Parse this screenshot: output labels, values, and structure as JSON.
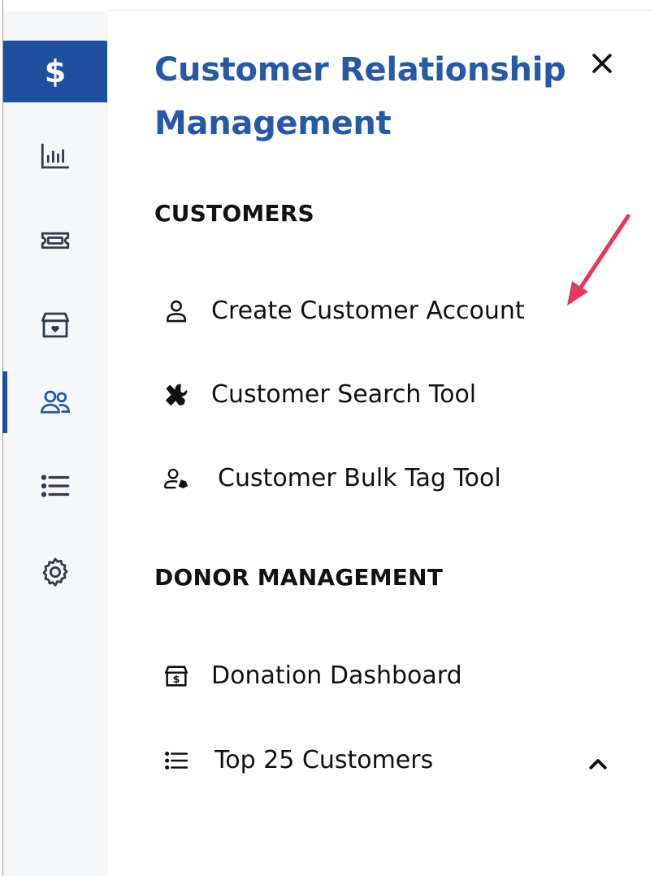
{
  "panel": {
    "title": "Customer Relationship Management",
    "close_icon": "close-icon"
  },
  "rail": {
    "items": [
      {
        "icon": "dollar-icon",
        "label": "$",
        "active": true
      },
      {
        "icon": "bar-chart-icon"
      },
      {
        "icon": "ticket-icon"
      },
      {
        "icon": "donation-box-icon"
      },
      {
        "icon": "users-icon",
        "selected": true
      },
      {
        "icon": "list-icon"
      },
      {
        "icon": "gear-icon"
      }
    ]
  },
  "sections": [
    {
      "heading": "CUSTOMERS",
      "items": [
        {
          "label": "Create Customer Account",
          "icon": "user-icon"
        },
        {
          "label": "Customer Search Tool",
          "icon": "tools-icon"
        },
        {
          "label": "Customer Bulk Tag Tool",
          "icon": "user-tag-icon"
        }
      ]
    },
    {
      "heading": "DONOR MANAGEMENT",
      "items": [
        {
          "label": "Donation Dashboard",
          "icon": "donation-box-icon"
        },
        {
          "label": "Top 25 Customers",
          "icon": "list-icon",
          "expanded": true
        }
      ]
    }
  ],
  "colors": {
    "brand": "#2558a6",
    "rail_active": "#1f4f9e",
    "rail_background": "#f6f7f9",
    "annotation_arrow": "#e8365d"
  }
}
